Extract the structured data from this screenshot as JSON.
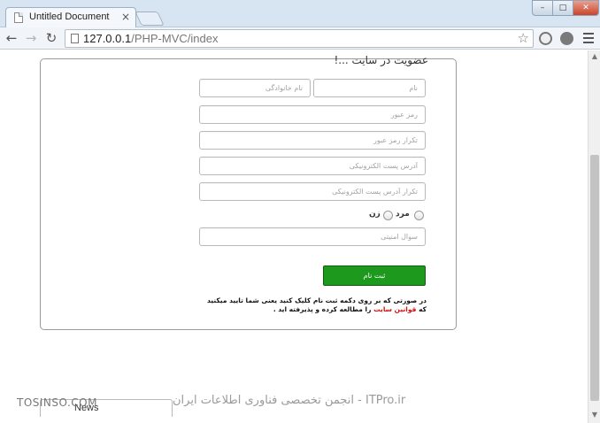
{
  "browser": {
    "tab_title": "Untitled Document",
    "tab_close": "×",
    "url_host": "127.0.0.1",
    "url_path": "/PHP-MVC/index",
    "star": "☆",
    "back": "←",
    "forward": "→",
    "reload": "↻",
    "win_min": "–",
    "win_max": "□",
    "win_close": "✕"
  },
  "form": {
    "title": "عضویت در سایت ...!",
    "name_placeholder": "نام",
    "family_placeholder": "نام خانوادگی",
    "password_placeholder": "رمز عبور",
    "password_repeat_placeholder": "تکرار رمز عبور",
    "email_placeholder": "آدرس پست الکترونیکی",
    "email_repeat_placeholder": "تکرار آدرس پست الکترونیکی",
    "gender_male": "مرد",
    "gender_female": "زن",
    "question_placeholder": "سوال امنیتی",
    "submit_label": "ثبت نام",
    "terms_line1": "در صورتی که بر روی دکمه ثبت نام کلیک کنید یعنی شما تایید میکنید",
    "terms_prefix": "که",
    "terms_link": "قوانین سایت",
    "terms_suffix": "را مطالعه کرده و پذیرفته اید ."
  },
  "watermark": {
    "left": "TOSINSO.COM",
    "middle": "ITPro.ir - انجمن تخصصی فناوری اطلاعات ایران"
  },
  "bottom": {
    "label": "News"
  },
  "colors": {
    "submit": "#1d9a1d",
    "terms_link": "#d41010"
  }
}
